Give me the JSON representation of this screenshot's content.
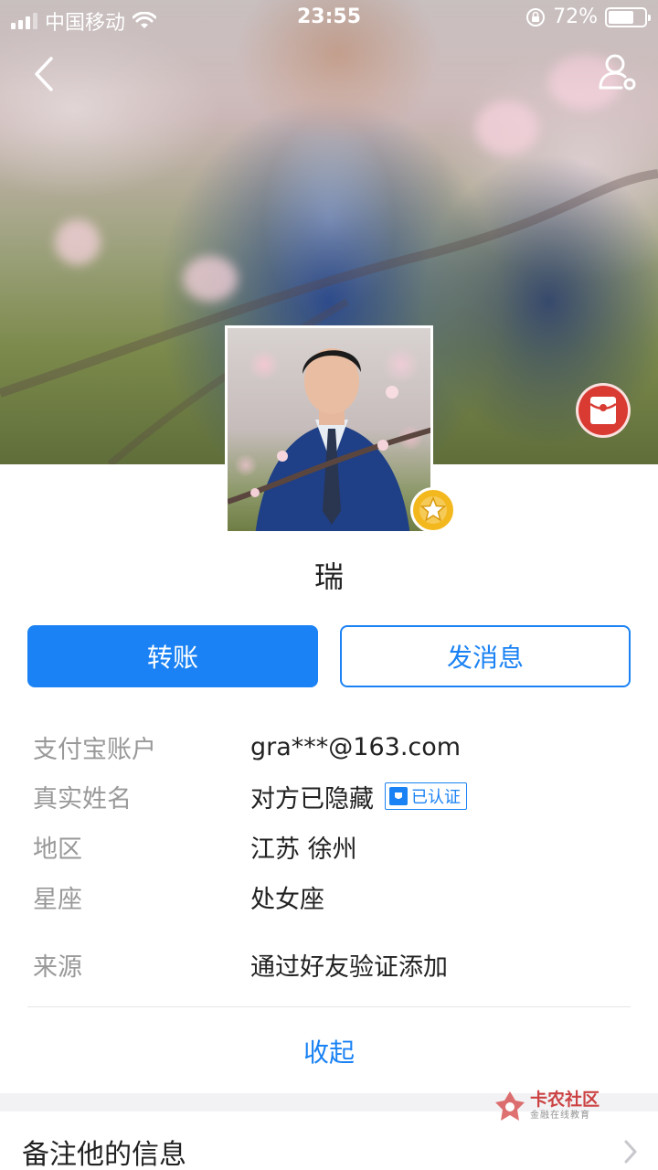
{
  "status_bar": {
    "carrier": "中国移动",
    "time": "23:55",
    "battery_percent": "72%",
    "battery_level": 0.72,
    "icons": [
      "signal-icon",
      "wifi-icon",
      "rotation-lock-icon",
      "battery-icon"
    ]
  },
  "nav": {
    "back_icon": "back-chevron-icon",
    "profile_icon": "user-settings-icon"
  },
  "profile": {
    "name": "瑞",
    "badge_icon": "star-badge-icon",
    "red_packet_icon": "red-packet-icon"
  },
  "actions": {
    "transfer_label": "转账",
    "message_label": "发消息"
  },
  "info": {
    "rows": [
      {
        "label": "支付宝账户",
        "value": "gra***@163.com"
      },
      {
        "label": "真实姓名",
        "value": "对方已隐藏",
        "tag": "已认证"
      },
      {
        "label": "地区",
        "value": "江苏 徐州"
      },
      {
        "label": "星座",
        "value": "处女座"
      },
      {
        "label": "来源",
        "value": "通过好友验证添加"
      }
    ]
  },
  "collapse_label": "收起",
  "remark": {
    "label": "备注他的信息"
  },
  "watermark": {
    "title": "卡农社区",
    "subtitle": "金融在线教育"
  },
  "colors": {
    "accent": "#1a82f4",
    "red_packet": "#d93a32",
    "badge": "#f3b81e",
    "label_gray": "#999999"
  }
}
